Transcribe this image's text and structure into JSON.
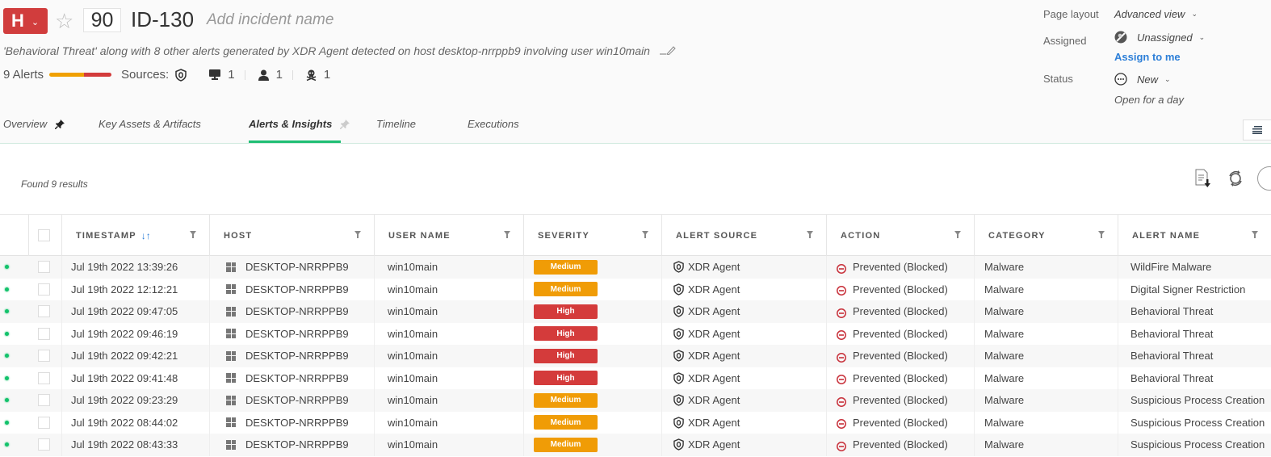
{
  "incident": {
    "severity_letter": "H",
    "severity_color": "#d13d3d",
    "starred": false,
    "score": "90",
    "id": "ID-130",
    "name_placeholder": "Add incident name",
    "description": "'Behavioral Threat' along with 8 other alerts generated by XDR Agent detected on host desktop-nrrppb9 involving user win10main",
    "alerts_label": "9 Alerts",
    "severity_distribution": {
      "medium": 5,
      "high": 4
    },
    "sources_label": "Sources:",
    "stats": {
      "hosts": "1",
      "users": "1",
      "artifacts": "1"
    }
  },
  "meta": {
    "page_layout_label": "Page layout",
    "page_layout_value": "Advanced view",
    "assigned_label": "Assigned",
    "assigned_value": "Unassigned",
    "assign_to_me": "Assign to me",
    "status_label": "Status",
    "status_value": "New",
    "open_for": "Open for a day"
  },
  "tabs": [
    {
      "label": "Overview",
      "pinned": true,
      "active": false
    },
    {
      "label": "Key Assets & Artifacts",
      "pinned": false,
      "active": false
    },
    {
      "label": "Alerts & Insights",
      "pinned": false,
      "active": true
    },
    {
      "label": "Timeline",
      "pinned": false,
      "active": false
    },
    {
      "label": "Executions",
      "pinned": false,
      "active": false
    }
  ],
  "results": {
    "found_label": "Found 9 results"
  },
  "table": {
    "columns": [
      "TIMESTAMP",
      "HOST",
      "USER NAME",
      "SEVERITY",
      "ALERT SOURCE",
      "ACTION",
      "CATEGORY",
      "ALERT NAME"
    ],
    "sort_column": "TIMESTAMP",
    "rows": [
      {
        "timestamp": "Jul 19th 2022 13:39:26",
        "host": "DESKTOP-NRRPPB9",
        "user": "win10main",
        "severity": "Medium",
        "source": "XDR Agent",
        "action": "Prevented (Blocked)",
        "category": "Malware",
        "alert_name": "WildFire Malware"
      },
      {
        "timestamp": "Jul 19th 2022 12:12:21",
        "host": "DESKTOP-NRRPPB9",
        "user": "win10main",
        "severity": "Medium",
        "source": "XDR Agent",
        "action": "Prevented (Blocked)",
        "category": "Malware",
        "alert_name": "Digital Signer Restriction"
      },
      {
        "timestamp": "Jul 19th 2022 09:47:05",
        "host": "DESKTOP-NRRPPB9",
        "user": "win10main",
        "severity": "High",
        "source": "XDR Agent",
        "action": "Prevented (Blocked)",
        "category": "Malware",
        "alert_name": "Behavioral Threat"
      },
      {
        "timestamp": "Jul 19th 2022 09:46:19",
        "host": "DESKTOP-NRRPPB9",
        "user": "win10main",
        "severity": "High",
        "source": "XDR Agent",
        "action": "Prevented (Blocked)",
        "category": "Malware",
        "alert_name": "Behavioral Threat"
      },
      {
        "timestamp": "Jul 19th 2022 09:42:21",
        "host": "DESKTOP-NRRPPB9",
        "user": "win10main",
        "severity": "High",
        "source": "XDR Agent",
        "action": "Prevented (Blocked)",
        "category": "Malware",
        "alert_name": "Behavioral Threat"
      },
      {
        "timestamp": "Jul 19th 2022 09:41:48",
        "host": "DESKTOP-NRRPPB9",
        "user": "win10main",
        "severity": "High",
        "source": "XDR Agent",
        "action": "Prevented (Blocked)",
        "category": "Malware",
        "alert_name": "Behavioral Threat"
      },
      {
        "timestamp": "Jul 19th 2022 09:23:29",
        "host": "DESKTOP-NRRPPB9",
        "user": "win10main",
        "severity": "Medium",
        "source": "XDR Agent",
        "action": "Prevented (Blocked)",
        "category": "Malware",
        "alert_name": "Suspicious Process Creation"
      },
      {
        "timestamp": "Jul 19th 2022 08:44:02",
        "host": "DESKTOP-NRRPPB9",
        "user": "win10main",
        "severity": "Medium",
        "source": "XDR Agent",
        "action": "Prevented (Blocked)",
        "category": "Malware",
        "alert_name": "Suspicious Process Creation"
      },
      {
        "timestamp": "Jul 19th 2022 08:43:33",
        "host": "DESKTOP-NRRPPB9",
        "user": "win10main",
        "severity": "Medium",
        "source": "XDR Agent",
        "action": "Prevented (Blocked)",
        "category": "Malware",
        "alert_name": "Suspicious Process Creation"
      }
    ]
  },
  "colors": {
    "accent_tab": "#1fbe74",
    "link": "#2d7fd8",
    "severity_medium": "#f09c06",
    "severity_high": "#d43b3b",
    "status_dot": "#13c26b",
    "blocked": "#c8303a"
  }
}
